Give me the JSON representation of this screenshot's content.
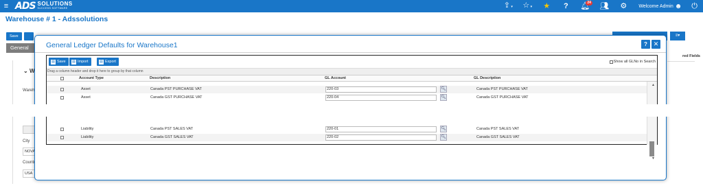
{
  "navbar": {
    "logo_mark": "ADS",
    "logo_big": "SOLUTIONS",
    "logo_small": "SUCCESS SOFTWARE",
    "notification_count": "24",
    "welcome": "Welcome Admin"
  },
  "page": {
    "title": "Warehouse # 1 - Adssolutions",
    "save_label": "Save",
    "tab_general": "General",
    "required_fields": "red Fields",
    "section_label": "Wa",
    "warehouse_label": "Wareho",
    "city_label": "City",
    "city_value": "NOVA",
    "country_label": "Country",
    "country_value": "USA"
  },
  "modal": {
    "title": "General Ledger Defaults for Warehouse1",
    "help_label": "?",
    "close_label": "✕"
  },
  "grid": {
    "toolbar": {
      "save": "Save",
      "import": "Import",
      "export": "Export"
    },
    "show_all_label": "Show all GLNo in Search",
    "group_hint": "Drag a column header and drop it here to group by that column",
    "columns": {
      "account_type": "Account Type",
      "description": "Description",
      "gl_account": "GL Account",
      "gl_description": "GL Description"
    },
    "rows": [
      {
        "account_type": "Asset",
        "description": "Canada PST PURCHASE VAT",
        "gl_account": "220-03",
        "gl_description": "Canada PST PURCHASE VAT"
      },
      {
        "account_type": "Asset",
        "description": "Canada GST PURCHASE VAT",
        "gl_account": "220-04",
        "gl_description": "Canada GST PURCHASE VAT"
      },
      {
        "account_type": "Liability",
        "description": "Canada PST SALES VAT",
        "gl_account": "220-01",
        "gl_description": "Canada PST SALES VAT"
      },
      {
        "account_type": "Liability",
        "description": "Canada GST SALES VAT",
        "gl_account": "220-02",
        "gl_description": "Canada GST SALES VAT"
      }
    ]
  },
  "colors": {
    "primary": "#1976c8",
    "star": "#f7c600",
    "badge": "#e53935"
  }
}
